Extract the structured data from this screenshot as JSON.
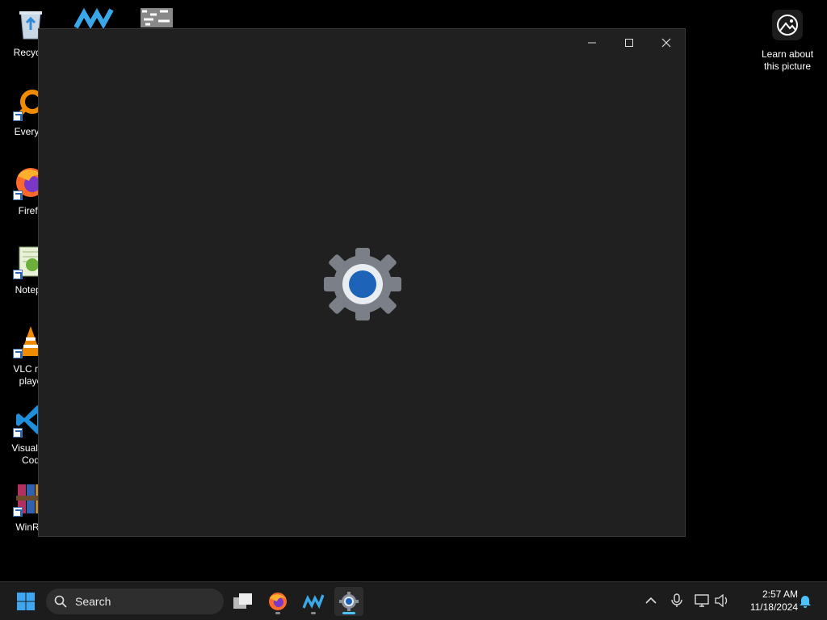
{
  "desktop": {
    "icons": [
      {
        "label": "Recycle"
      },
      {
        "label": "Everyth"
      },
      {
        "label": "Firefo"
      },
      {
        "label": "Notepa"
      },
      {
        "label": "VLC me playe"
      },
      {
        "label": "Visual St Cod"
      },
      {
        "label": "WinRA"
      }
    ],
    "spotlight": {
      "label": "Learn about this picture"
    }
  },
  "window": {
    "app_icon": "settings-gear-icon"
  },
  "taskbar": {
    "search_placeholder": "Search",
    "clock_time": "2:57 AM",
    "clock_date": "11/18/2024"
  }
}
